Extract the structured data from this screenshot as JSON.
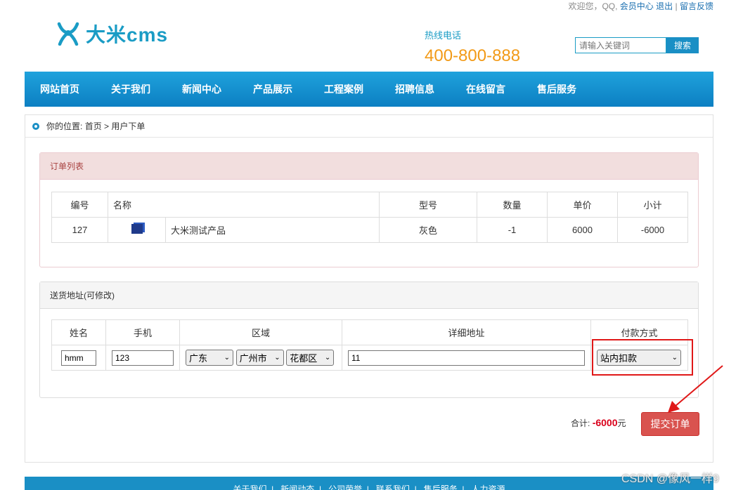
{
  "topbar": {
    "welcome": "欢迎您，QQ,",
    "member_center": "会员中心",
    "logout": "退出",
    "separator": "|",
    "feedback": "留言反馈"
  },
  "logo": {
    "text": "大米cms",
    "icon": "logo-figure-icon"
  },
  "hotline": {
    "label": "热线电话",
    "number": "400-800-888"
  },
  "search": {
    "placeholder": "请输入关键词",
    "button": "搜索"
  },
  "nav": {
    "items": [
      "网站首页",
      "关于我们",
      "新闻中心",
      "产品展示",
      "工程案例",
      "招聘信息",
      "在线留言",
      "售后服务"
    ]
  },
  "breadcrumb": {
    "prefix": "你的位置:",
    "home": "首页",
    "separator": ">",
    "current": "用户下单"
  },
  "order": {
    "title": "订单列表",
    "headers": {
      "id": "编号",
      "name": "名称",
      "model": "型号",
      "qty": "数量",
      "price": "单价",
      "subtotal": "小计"
    },
    "row": {
      "id": "127",
      "name": "大米测试产品",
      "model": "灰色",
      "qty": "-1",
      "price": "6000",
      "subtotal": "-6000"
    }
  },
  "address": {
    "title": "送货地址(可修改)",
    "headers": {
      "name": "姓名",
      "phone": "手机",
      "region": "区域",
      "detail": "详细地址",
      "payment": "付款方式"
    },
    "values": {
      "name": "hmm",
      "phone": "123",
      "province": "广东",
      "city": "广州市",
      "district": "花都区",
      "detail": "11",
      "payment": "站内扣款"
    }
  },
  "summary": {
    "label": "合计:",
    "amount": "-6000",
    "unit": "元",
    "submit": "提交订单"
  },
  "footer": {
    "links": [
      "关于我们",
      "新闻动态",
      "公司荣誉",
      "联系我们",
      "售后服务",
      "人力资源"
    ]
  },
  "watermark": "CSDN @像风一样9",
  "colors": {
    "brand": "#1a9cc5",
    "hotline": "#f29a17",
    "danger": "#d9534f",
    "annotation": "#e01818"
  }
}
